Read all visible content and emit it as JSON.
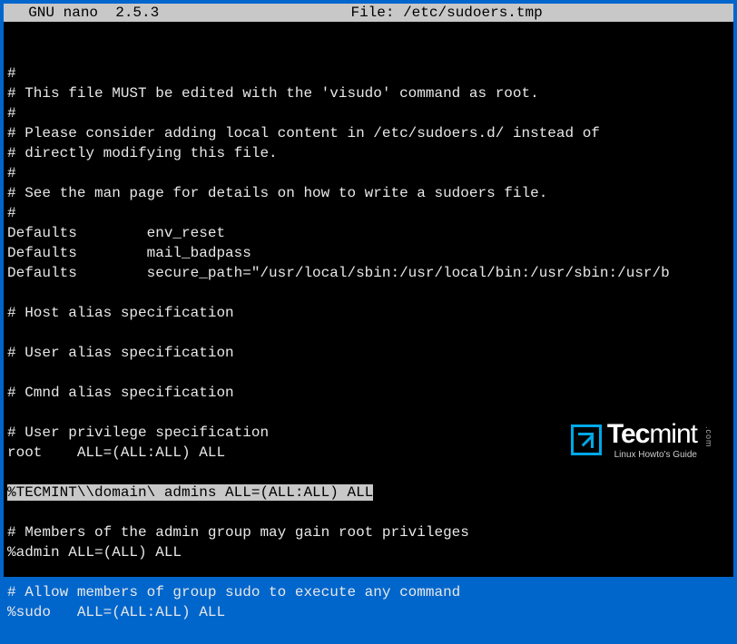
{
  "header": {
    "app": "  GNU nano  2.5.3",
    "spacer": "                      ",
    "file": "File: /etc/sudoers.tmp"
  },
  "lines": {
    "l0": "",
    "l1": "#",
    "l2": "# This file MUST be edited with the 'visudo' command as root.",
    "l3": "#",
    "l4": "# Please consider adding local content in /etc/sudoers.d/ instead of",
    "l5": "# directly modifying this file.",
    "l6": "#",
    "l7": "# See the man page for details on how to write a sudoers file.",
    "l8": "#",
    "l9": "Defaults        env_reset",
    "l10": "Defaults        mail_badpass",
    "l11": "Defaults        secure_path=\"/usr/local/sbin:/usr/local/bin:/usr/sbin:/usr/b",
    "l12": "",
    "l13": "# Host alias specification",
    "l14": "",
    "l15": "# User alias specification",
    "l16": "",
    "l17": "# Cmnd alias specification",
    "l18": "",
    "l19": "# User privilege specification",
    "l20": "root    ALL=(ALL:ALL) ALL",
    "l21": "",
    "highlighted": "%TECMINT\\\\domain\\ admins ALL=(ALL:ALL) ALL",
    "l23": "",
    "l24": "# Members of the admin group may gain root privileges",
    "l25": "%admin ALL=(ALL) ALL",
    "l26": "",
    "l27": "# Allow members of group sudo to execute any command",
    "l28": "%sudo   ALL=(ALL:ALL) ALL"
  },
  "watermark": {
    "brand_bold": "Tec",
    "brand_light": "mint",
    "sub": "Linux Howto's Guide",
    "dotcom": ".com"
  }
}
